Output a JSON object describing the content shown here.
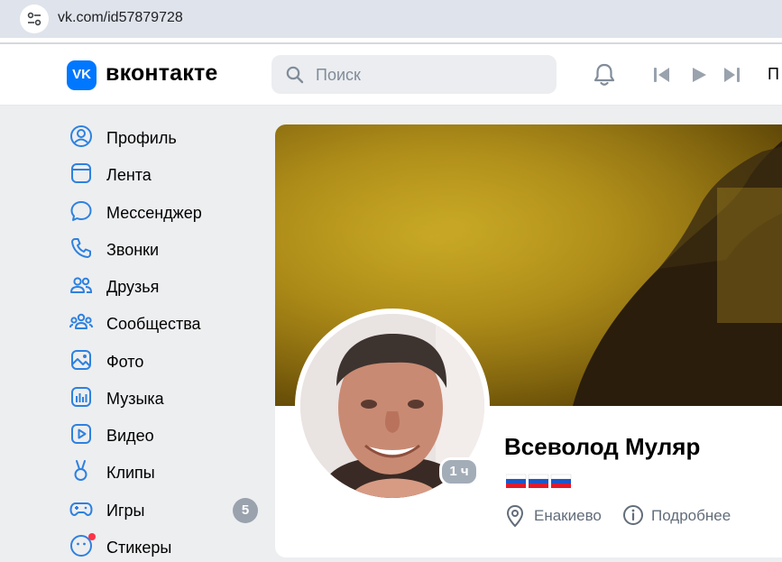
{
  "browser": {
    "url": "vk.com/id57879728"
  },
  "header": {
    "logo_letters": "VK",
    "brand": "вконтакте",
    "search_placeholder": "Поиск",
    "cut_text": "П"
  },
  "sidebar": {
    "items": [
      {
        "label": "Профиль",
        "icon": "profile-icon"
      },
      {
        "label": "Лента",
        "icon": "feed-icon"
      },
      {
        "label": "Мессенджер",
        "icon": "messenger-icon"
      },
      {
        "label": "Звонки",
        "icon": "phone-icon"
      },
      {
        "label": "Друзья",
        "icon": "friends-icon"
      },
      {
        "label": "Сообщества",
        "icon": "communities-icon"
      },
      {
        "label": "Фото",
        "icon": "photo-icon"
      },
      {
        "label": "Музыка",
        "icon": "music-icon"
      },
      {
        "label": "Видео",
        "icon": "video-icon"
      },
      {
        "label": "Клипы",
        "icon": "clips-icon"
      },
      {
        "label": "Игры",
        "icon": "games-icon",
        "badge": "5"
      },
      {
        "label": "Стикеры",
        "icon": "stickers-icon"
      }
    ]
  },
  "profile": {
    "name": "Всеволод Муляр",
    "online_time": "1 ч",
    "flags": [
      "ru",
      "ru",
      "ru"
    ],
    "city": "Енакиево",
    "more_label": "Подробнее"
  },
  "colors": {
    "brand": "#0077ff",
    "icon_blue": "#2d81e0",
    "badge_gray": "#99a2ad"
  }
}
